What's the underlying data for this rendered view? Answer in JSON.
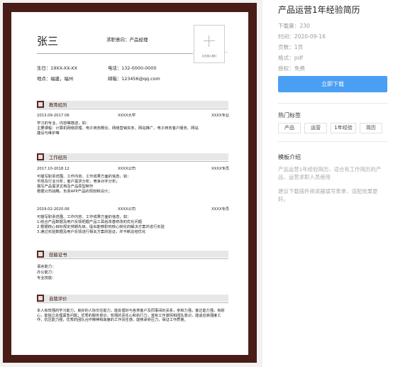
{
  "resume": {
    "name": "张三",
    "job_target": "求职意向：产品经理",
    "photo_text": "点击插入照片",
    "photo_dots": "...",
    "birth": "生日：19XX-XX-XX",
    "phone": "电话：132-0000-0000",
    "location": "地点：福建，福州",
    "email": "邮箱：123456@qq.com",
    "education": {
      "title": "教育经历",
      "period": "2013.09-2017.06",
      "school": "XXXX大学",
      "major": "XXXX专业",
      "line1": "学习的专业、内容等描述，如：",
      "line2": "主要课程：计算机网络原理、电子商务概论、网络营销实务、网站推广、电子商务客户服务、网站",
      "line3": "建设与维护等"
    },
    "work": {
      "title": "工作经历",
      "job1": {
        "period": "2017.10-2018.12",
        "company": "XXXX公司",
        "role": "XXXX专员",
        "line1": "可描写职责范围、工作内容、工作成果方面的信息，如：",
        "line2": "市场及行业分析，客户需求分析，竞争对手分析；",
        "line3": "撰写产品需求文档及产品原型制作",
        "line4": "根据公司战略，负责APP产品的规划和设计；"
      },
      "job2": {
        "period": "2019.02-2020.06",
        "company": "XXXX公司",
        "role": "XXXX专员",
        "line1": "可描写职责范围、工作内容、工作成果方面的信息，如：",
        "line2": "1.结合产品数据及用户反馈把握产品工具给改善修改的优化问题",
        "line3": "2.根据核心目标规定排期先级，提出能够影响核心转化的解决方案并进行实验",
        "line4": "3.通过实验数据及用户反馈进行相关方案的验证，并不断总结优化"
      }
    },
    "skills": {
      "title": "技能证书",
      "line1": "语言能力：",
      "line2": "办公能力：",
      "line3": "专业技能："
    },
    "evaluation": {
      "title": "自我评价",
      "text": "本人有较强的学习能力，良好的人际交往能力，能处理好与各类客户及同事间的关系，亲和力强，客达能力强，有耐心，能独立处理紧急问题；优秀的服务意识，较强的责任心和执行力，富有工作激情和团队意识，能适应高强度工作，抗压能力强，优秀的团队合作精神和高度的工作责任感，能够承受压力，保证工作质量。"
    }
  },
  "sidebar": {
    "title": "产品运营1年经验简历",
    "downloads": "下载量：230",
    "time": "时间：2020-09-16",
    "pages": "页数：1页",
    "format": "格式：pdf",
    "license": "授权：免费",
    "download_button": "立即下载",
    "tags_heading": "热门标签",
    "tags": [
      "产品",
      "运营",
      "1年经验",
      "简历"
    ],
    "intro_heading": "模板介绍",
    "intro_text1": "产品运营1年经验简历，适合有工作简历的产品、运营求职人员使用",
    "intro_text2": "建议下载插件阅读器填写表单，适配效果更好。",
    "accent_color": "#4a9ef3",
    "theme_color": "#4a1c17"
  }
}
